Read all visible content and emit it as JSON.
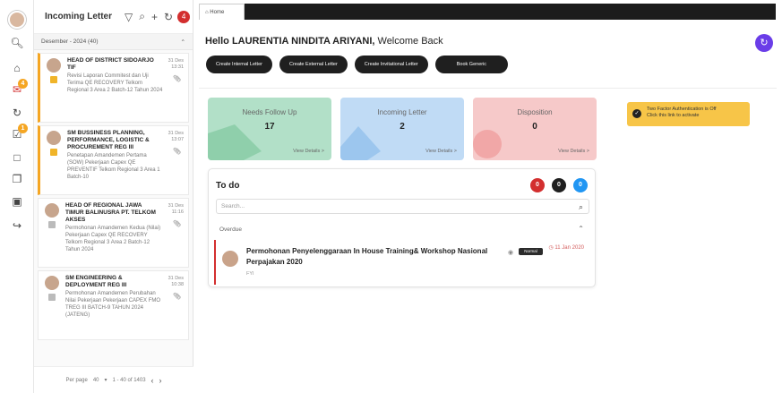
{
  "app": {
    "title": "Incoming Letter"
  },
  "rail": {
    "badge_letter": "4",
    "badge_check": "1"
  },
  "list": {
    "header": {
      "title": "Incoming Letter",
      "badge": "4"
    },
    "filter": {
      "label": "Desember - 2024 (40)"
    },
    "items": [
      {
        "name": "HEAD OF DISTRICT SIDOARJO TIF",
        "desc": "Revisi Laporan Commitest dan Uji Terima QE RECOVERY Telkom Regional 3 Area 2 Batch-12 Tahun 2024",
        "date": "31 Des 13:31"
      },
      {
        "name": "SM BUSSINESS PLANNING, PERFORMANCE, LOGISTIC & PROCUREMENT REG III",
        "desc": "Penetapan Amandemen Pertama (SOW) Pekerjaan Capex QE PREVENTIF Telkom Regional 3 Area 1 Batch-10",
        "date": "31 Des 13:07"
      },
      {
        "name": "HEAD OF REGIONAL JAWA TIMUR BALINUSRA PT. TELKOM AKSES",
        "desc": "Permohonan Amandemen Kedua (Nilai) Pekerjaan Capex QE RECOVERY Telkom Regional 3 Area 2 Batch-12 Tahun 2024",
        "date": "31 Des 11:16"
      },
      {
        "name": "SM ENGINEERING & DEPLOYMENT REG III",
        "desc": "Permohonan Amandemen Perubahan Nilai Pekerjaan Pekerjaan CAPEX FMO TREG III BATCH-9 TAHUN 2024 (JATENG)",
        "date": "31 Des 10:38"
      }
    ],
    "footer": {
      "per_page_label": "Per page",
      "per_page": "40",
      "range": "1 - 40 of 1403"
    }
  },
  "topbar": {
    "tab": "Home"
  },
  "main": {
    "greeting_name": "Hello LAURENTIA NINDITA ARIYANI,",
    "greeting_rest": " Welcome Back",
    "buttons": [
      "Create Internal Letter",
      "Create External Letter",
      "Create Invitational Letter",
      "Book Generic"
    ],
    "cards": [
      {
        "title": "Needs Follow Up",
        "value": "17",
        "link": "View Details >",
        "color": "#a8dcc0"
      },
      {
        "title": "Incoming Letter",
        "value": "2",
        "link": "View Details >",
        "color": "#b9d8f4"
      },
      {
        "title": "Disposition",
        "value": "0",
        "link": "View Details >",
        "color": "#f5c4c4"
      }
    ],
    "twofa": {
      "text": "Two Factor Authentication is Off",
      "sub": "Click this link to activate"
    },
    "todo": {
      "title": "To do",
      "counts": [
        {
          "value": "0",
          "color": "#d32f2f"
        },
        {
          "value": "0",
          "color": "#1f1f1f"
        },
        {
          "value": "0",
          "color": "#2196f3"
        }
      ],
      "search_placeholder": "Search...",
      "section": "Overdue",
      "row": {
        "title": "Permohonan Penyelenggaraan In House Training& Workshop Nasional Perpajakan 2020",
        "sub": "FYI",
        "badge": "Normal",
        "due": "11 Jan 2020"
      }
    }
  }
}
